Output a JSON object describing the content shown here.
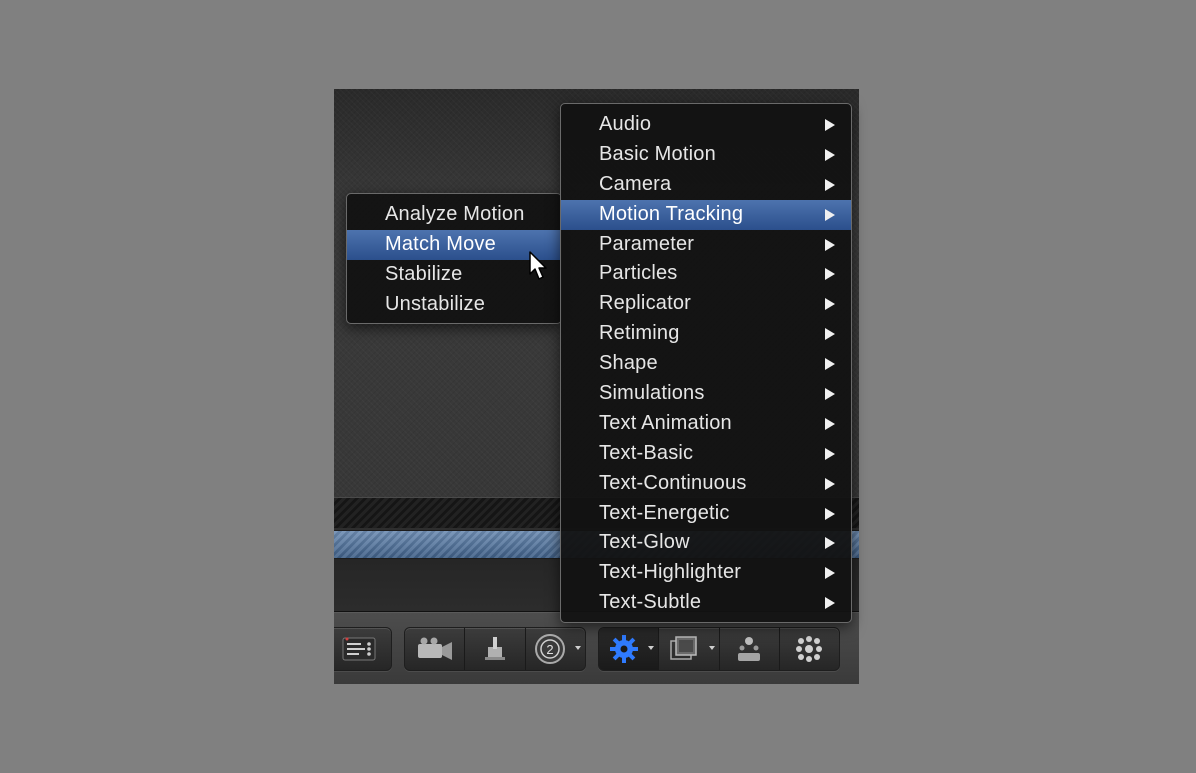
{
  "main_menu": {
    "items": [
      {
        "label": "Audio",
        "has_submenu": true,
        "highlighted": false
      },
      {
        "label": "Basic Motion",
        "has_submenu": true,
        "highlighted": false
      },
      {
        "label": "Camera",
        "has_submenu": true,
        "highlighted": false
      },
      {
        "label": "Motion Tracking",
        "has_submenu": true,
        "highlighted": true
      },
      {
        "label": "Parameter",
        "has_submenu": true,
        "highlighted": false
      },
      {
        "label": "Particles",
        "has_submenu": true,
        "highlighted": false
      },
      {
        "label": "Replicator",
        "has_submenu": true,
        "highlighted": false
      },
      {
        "label": "Retiming",
        "has_submenu": true,
        "highlighted": false
      },
      {
        "label": "Shape",
        "has_submenu": true,
        "highlighted": false
      },
      {
        "label": "Simulations",
        "has_submenu": true,
        "highlighted": false
      },
      {
        "label": "Text Animation",
        "has_submenu": true,
        "highlighted": false
      },
      {
        "label": "Text-Basic",
        "has_submenu": true,
        "highlighted": false
      },
      {
        "label": "Text-Continuous",
        "has_submenu": true,
        "highlighted": false
      },
      {
        "label": "Text-Energetic",
        "has_submenu": true,
        "highlighted": false
      },
      {
        "label": "Text-Glow",
        "has_submenu": true,
        "highlighted": false
      },
      {
        "label": "Text-Highlighter",
        "has_submenu": true,
        "highlighted": false
      },
      {
        "label": "Text-Subtle",
        "has_submenu": true,
        "highlighted": false
      }
    ]
  },
  "submenu": {
    "items": [
      {
        "label": "Analyze Motion",
        "highlighted": false
      },
      {
        "label": "Match Move",
        "highlighted": true
      },
      {
        "label": "Stabilize",
        "highlighted": false
      },
      {
        "label": "Unstabilize",
        "highlighted": false
      }
    ]
  },
  "toolbar": {
    "groups": [
      {
        "name": "layers",
        "buttons": [
          {
            "icon": "list-options-icon"
          }
        ]
      },
      {
        "name": "view",
        "buttons": [
          {
            "icon": "video-camera-icon"
          },
          {
            "icon": "light-icon"
          },
          {
            "icon": "replicator-count-icon",
            "badge": "2",
            "has_dropdown": true
          }
        ]
      },
      {
        "name": "add",
        "buttons": [
          {
            "icon": "gear-behaviors-icon",
            "active": true,
            "has_dropdown": true
          },
          {
            "icon": "filters-icon",
            "has_dropdown": true
          },
          {
            "icon": "emitter-icon"
          },
          {
            "icon": "particles-grid-icon"
          }
        ]
      }
    ]
  },
  "colors": {
    "highlight": "#3a62a0",
    "gear_active": "#2f7bff",
    "background": "#808080"
  }
}
